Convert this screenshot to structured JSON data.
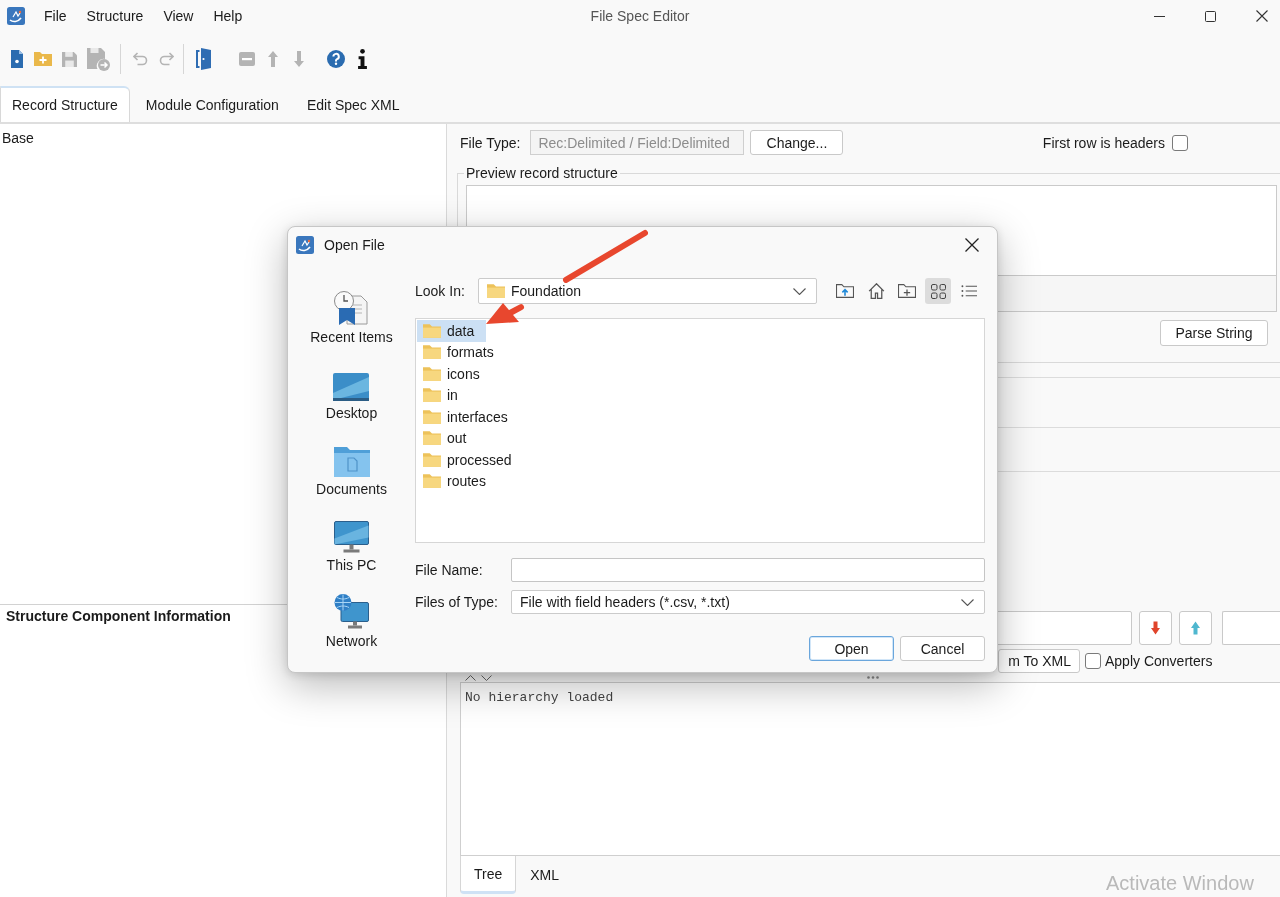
{
  "window": {
    "title": "File Spec Editor"
  },
  "menu": [
    "File",
    "Structure",
    "View",
    "Help"
  ],
  "toolbar": [
    {
      "kind": "new-file",
      "disabled": false
    },
    {
      "kind": "open-folder",
      "disabled": false
    },
    {
      "kind": "save",
      "disabled": true
    },
    {
      "kind": "save-as",
      "disabled": true
    },
    {
      "kind": "separator"
    },
    {
      "kind": "undo",
      "disabled": true
    },
    {
      "kind": "redo",
      "disabled": true
    },
    {
      "kind": "separator"
    },
    {
      "kind": "exit",
      "disabled": false
    },
    {
      "kind": "remove",
      "disabled": true
    },
    {
      "kind": "move-up",
      "disabled": true
    },
    {
      "kind": "move-down",
      "disabled": true
    },
    {
      "kind": "help",
      "disabled": false
    },
    {
      "kind": "info",
      "disabled": false
    }
  ],
  "tabs": [
    {
      "label": "Record Structure",
      "selected": true
    },
    {
      "label": "Module Configuration",
      "selected": false
    },
    {
      "label": "Edit Spec XML",
      "selected": false
    }
  ],
  "tree": {
    "items": [
      {
        "label": "Base"
      }
    ]
  },
  "info_panel": {
    "title": "Structure Component Information"
  },
  "file_type": {
    "label": "File Type:",
    "value": "Rec:Delimited / Field:Delimited",
    "disabled": true,
    "button": "Change..."
  },
  "first_row_headers": {
    "label": "First row is headers",
    "checked": false
  },
  "preview": {
    "title": "Preview record structure",
    "button": "Parse String"
  },
  "xml_button": "m To XML",
  "apply_converters": {
    "label": "Apply Converters",
    "checked": false
  },
  "hierarchy": {
    "message": "No hierarchy loaded"
  },
  "bottom_tabs": [
    {
      "label": "Tree",
      "selected": true
    },
    {
      "label": "XML",
      "selected": false
    }
  ],
  "activation_notice": "Activate Window",
  "dialog": {
    "title": "Open File",
    "places": [
      {
        "kind": "recent",
        "label": "Recent Items"
      },
      {
        "kind": "desktop",
        "label": "Desktop"
      },
      {
        "kind": "documents",
        "label": "Documents"
      },
      {
        "kind": "computer",
        "label": "This PC"
      },
      {
        "kind": "network",
        "label": "Network"
      }
    ],
    "look_in": {
      "label": "Look In:",
      "value": "Foundation"
    },
    "nav_buttons": [
      {
        "kind": "up-folder"
      },
      {
        "kind": "home"
      },
      {
        "kind": "new-folder"
      }
    ],
    "view_modes": [
      {
        "kind": "grid",
        "selected": true
      },
      {
        "kind": "list",
        "selected": false
      }
    ],
    "files": [
      {
        "name": "data",
        "selected": true
      },
      {
        "name": "formats",
        "selected": false
      },
      {
        "name": "icons",
        "selected": false
      },
      {
        "name": "in",
        "selected": false
      },
      {
        "name": "interfaces",
        "selected": false
      },
      {
        "name": "out",
        "selected": false
      },
      {
        "name": "processed",
        "selected": false
      },
      {
        "name": "routes",
        "selected": false
      }
    ],
    "file_name": {
      "label": "File Name:"
    },
    "file_type": {
      "label": "Files of Type:",
      "value": "File with field headers (*.csv, *.txt)"
    },
    "buttons": [
      {
        "label": "Open",
        "focused": true
      },
      {
        "label": "Cancel",
        "focused": false
      }
    ]
  }
}
